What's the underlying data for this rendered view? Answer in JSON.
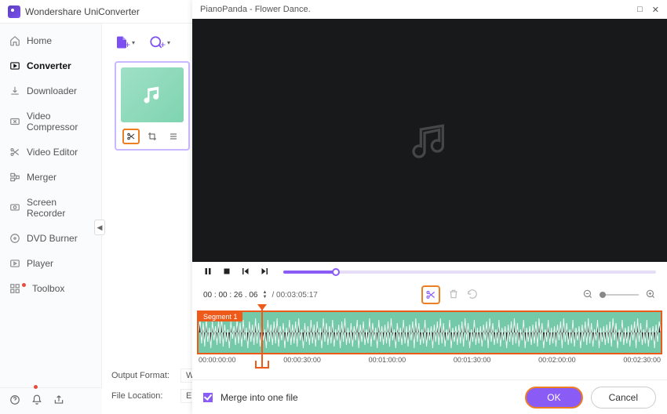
{
  "app": {
    "title": "Wondershare UniConverter"
  },
  "window_controls": {
    "minimize": "—",
    "maximize": "□",
    "close": "✕"
  },
  "sidebar": {
    "items": [
      {
        "label": "Home"
      },
      {
        "label": "Converter"
      },
      {
        "label": "Downloader"
      },
      {
        "label": "Video Compressor"
      },
      {
        "label": "Video Editor"
      },
      {
        "label": "Merger"
      },
      {
        "label": "Screen Recorder"
      },
      {
        "label": "DVD Burner"
      },
      {
        "label": "Player"
      },
      {
        "label": "Toolbox"
      }
    ]
  },
  "output": {
    "format_label": "Output Format:",
    "format_value": "WAV",
    "location_label": "File Location:",
    "location_value": "E:\\Wondersh"
  },
  "editor": {
    "title": "PianoPanda - Flower Dance.",
    "time_in": "00 : 00 : 26 . 06",
    "time_total": "/ 00:03:05:17",
    "segment_label": "Segment 1",
    "ticks": [
      "00:00:00:00",
      "00:00:30:00",
      "00:01:00:00",
      "00:01:30:00",
      "00:02:00:00",
      "00:02:30:00"
    ],
    "merge_label": "Merge into one file",
    "ok": "OK",
    "cancel": "Cancel"
  }
}
